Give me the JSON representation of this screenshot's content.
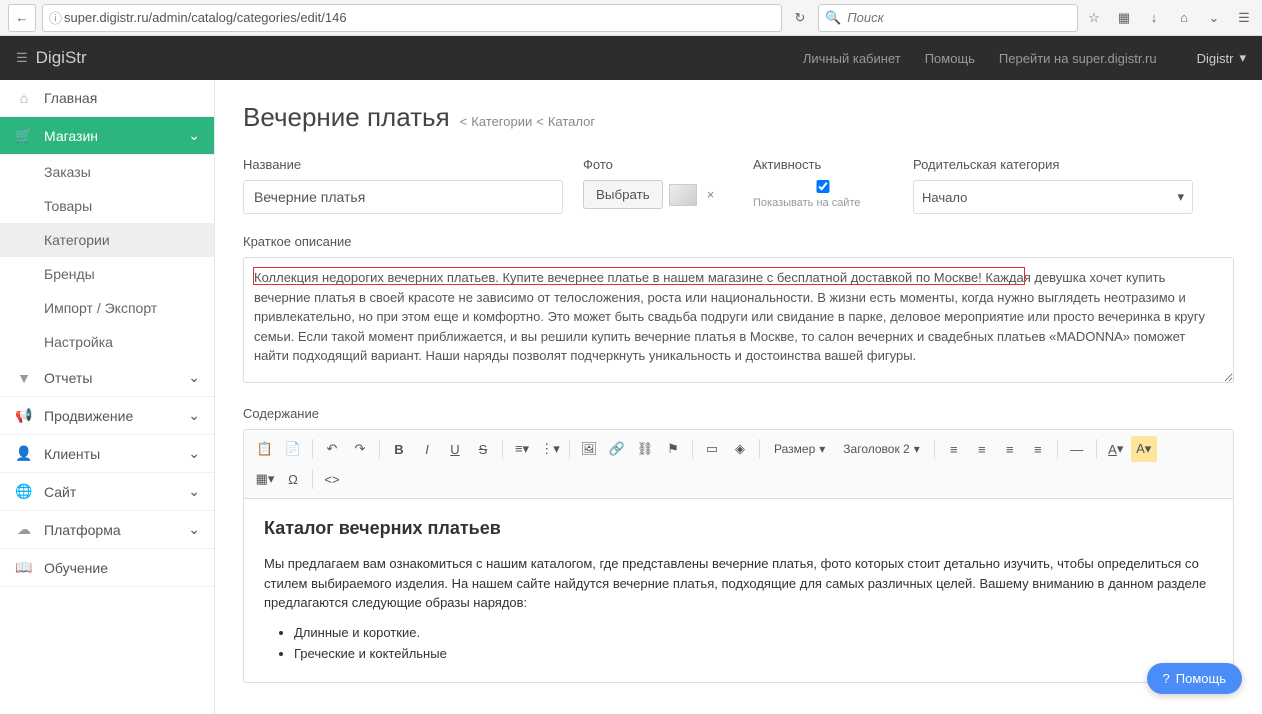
{
  "browser": {
    "url": "super.digistr.ru/admin/catalog/categories/edit/146",
    "search_placeholder": "Поиск"
  },
  "topbar": {
    "brand": "DigiStr",
    "links": [
      "Личный кабинет",
      "Помощь",
      "Перейти на super.digistr.ru"
    ],
    "user": "Digistr"
  },
  "sidebar": {
    "items": [
      {
        "icon": "home",
        "label": "Главная"
      },
      {
        "icon": "cart",
        "label": "Магазин",
        "active": true,
        "children": [
          {
            "label": "Заказы"
          },
          {
            "label": "Товары"
          },
          {
            "label": "Категории",
            "current": true
          },
          {
            "label": "Бренды"
          },
          {
            "label": "Импорт / Экспорт"
          },
          {
            "label": "Настройка"
          }
        ]
      },
      {
        "icon": "filter",
        "label": "Отчеты"
      },
      {
        "icon": "bullhorn",
        "label": "Продвижение"
      },
      {
        "icon": "user",
        "label": "Клиенты"
      },
      {
        "icon": "globe",
        "label": "Сайт"
      },
      {
        "icon": "cloud",
        "label": "Платформа"
      },
      {
        "icon": "book",
        "label": "Обучение"
      }
    ]
  },
  "page": {
    "title": "Вечерние платья",
    "breadcrumb": [
      "Категории",
      "Каталог"
    ]
  },
  "form": {
    "name_label": "Название",
    "name_value": "Вечерние платья",
    "photo_label": "Фото",
    "photo_button": "Выбрать",
    "activity_label": "Активность",
    "activity_hint": "Показывать на сайте",
    "parent_label": "Родительская категория",
    "parent_value": "Начало",
    "short_label": "Краткое описание",
    "short_text": "Коллекция недорогих вечерних платьев. Купите вечернее платье в нашем магазине с бесплатной доставкой по Москве! Каждая девушка хочет купить вечерние платья в своей красоте не зависимо от телосложения, роста или национальности. В жизни есть моменты, когда нужно выглядеть неотразимо и привлекательно, но при этом еще и комфортно. Это может быть свадьба подруги или свидание в парке, деловое мероприятие или просто вечеринка в кругу семьи. Если такой момент приближается, и вы решили купить вечерние платья в Москве, то салон вечерних и свадебных платьев «MADONNA» поможет найти подходящий вариант. Наши наряды позволят подчеркнуть уникальность и достоинства вашей фигуры.",
    "content_label": "Содержание",
    "editor": {
      "size_label": "Размер",
      "heading_label": "Заголовок 2",
      "body_title": "Каталог вечерних платьев",
      "body_text": "Мы предлагаем вам ознакомиться с нашим каталогом, где представлены вечерние платья, фото которых стоит детально изучить, чтобы определиться со стилем выбираемого изделия. На нашем сайте найдутся вечерние платья, подходящие для самых различных целей. Вашему вниманию в данном разделе предлагаются следующие образы нарядов:",
      "list": [
        "Длинные и короткие.",
        "Греческие и коктейльные"
      ]
    }
  },
  "help_widget": "Помощь"
}
